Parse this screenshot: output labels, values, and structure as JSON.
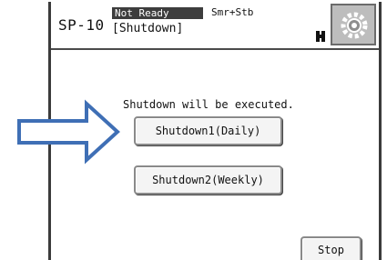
{
  "header": {
    "model": "SP-10",
    "status": "Not Ready",
    "mode": "Smr+Stb",
    "subtitle": "[Shutdown]"
  },
  "icons": {
    "settings": "gear-icon",
    "small": "page-icon",
    "callout": "arrow-right-icon"
  },
  "main": {
    "message": "Shutdown will be executed.",
    "daily_label": "Shutdown1(Daily)",
    "weekly_label": "Shutdown2(Weekly)",
    "stop_label": "Stop"
  },
  "colors": {
    "arrow": "#3f6fb5",
    "status_bg": "#3d3d3d"
  }
}
